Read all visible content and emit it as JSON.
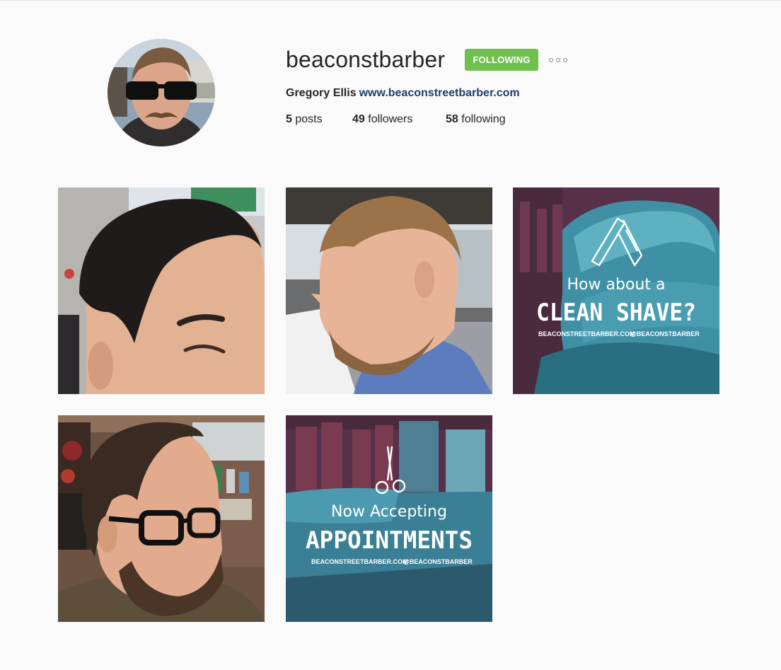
{
  "profile": {
    "username": "beaconstbarber",
    "full_name": "Gregory Ellis",
    "website": "www.beaconstreetbarber.com",
    "follow_button_label": "FOLLOWING",
    "options_icon": "more-options-icon"
  },
  "stats": {
    "posts": {
      "count": "5",
      "label": "posts"
    },
    "followers": {
      "count": "49",
      "label": "followers"
    },
    "following": {
      "count": "58",
      "label": "following"
    }
  },
  "posts": [
    {
      "kind": "photo"
    },
    {
      "kind": "photo"
    },
    {
      "kind": "graphic",
      "line1": "How about a",
      "line2": "CLEAN SHAVE?",
      "website": "BEACONSTREETBARBER.COM",
      "handle": "@BEACONSTBARBER",
      "icon": "straight-razor-icon"
    },
    {
      "kind": "photo"
    },
    {
      "kind": "graphic",
      "line1": "Now Accepting",
      "line2": "APPOINTMENTS",
      "website": "BEACONSTREETBARBER.COM",
      "handle": "@BEACONSTBARBER",
      "icon": "scissors-icon"
    }
  ],
  "colors": {
    "background": "#fafafa",
    "follow_button": "#70c050",
    "link": "#1d3f6e",
    "graphic_teal": "#3a8fa0",
    "graphic_maroon": "#5b2f45"
  }
}
